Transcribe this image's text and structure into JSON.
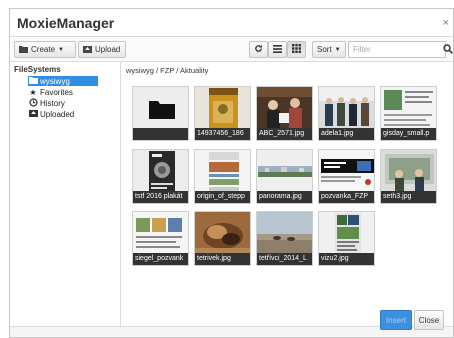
{
  "window": {
    "title": "MoxieManager",
    "close_glyph": "×"
  },
  "toolbar": {
    "create_label": "Create",
    "upload_label": "Upload",
    "sort_label": "Sort",
    "filter_placeholder": "Filter",
    "icons": {
      "create": "folder-icon",
      "upload": "upload-icon",
      "refresh": "refresh-icon",
      "list": "list-view-icon",
      "thumbs": "thumbnail-view-icon",
      "search": "search-icon"
    }
  },
  "sidebar": {
    "heading": "FileSystems",
    "items": [
      {
        "label": "wysiwyg",
        "icon": "folder-icon",
        "selected": true
      },
      {
        "label": "Favorites",
        "icon": "star-icon",
        "selected": false
      },
      {
        "label": "History",
        "icon": "history-icon",
        "selected": false
      },
      {
        "label": "Uploaded",
        "icon": "upload-icon",
        "selected": false
      }
    ]
  },
  "main": {
    "breadcrumb": "wysiwyg / FZP / Aktuality",
    "files": [
      {
        "name": "",
        "kind": "folder"
      },
      {
        "name": "14937456_186",
        "kind": "image"
      },
      {
        "name": "ABC_2571.jpg",
        "kind": "image"
      },
      {
        "name": "adela1.jpg",
        "kind": "image"
      },
      {
        "name": "gisday_small.p",
        "kind": "image"
      },
      {
        "name": "tstf 2016 plakát",
        "kind": "image"
      },
      {
        "name": "origin_of_stepp",
        "kind": "image"
      },
      {
        "name": "panorama.jpg",
        "kind": "image"
      },
      {
        "name": "pozvanka_FZP",
        "kind": "image"
      },
      {
        "name": "seth3.jpg",
        "kind": "image"
      },
      {
        "name": "siegel_pozvank",
        "kind": "image"
      },
      {
        "name": "tetrivek.jpg",
        "kind": "image"
      },
      {
        "name": "tetřívci_2014_L",
        "kind": "image"
      },
      {
        "name": "vizu2.jpg",
        "kind": "image"
      }
    ]
  },
  "footer": {
    "insert_label": "Insert",
    "close_label": "Close"
  },
  "colors": {
    "accent": "#2f8ee3",
    "insert_button": "#3d8fe0",
    "caption_bg": "#333333"
  }
}
